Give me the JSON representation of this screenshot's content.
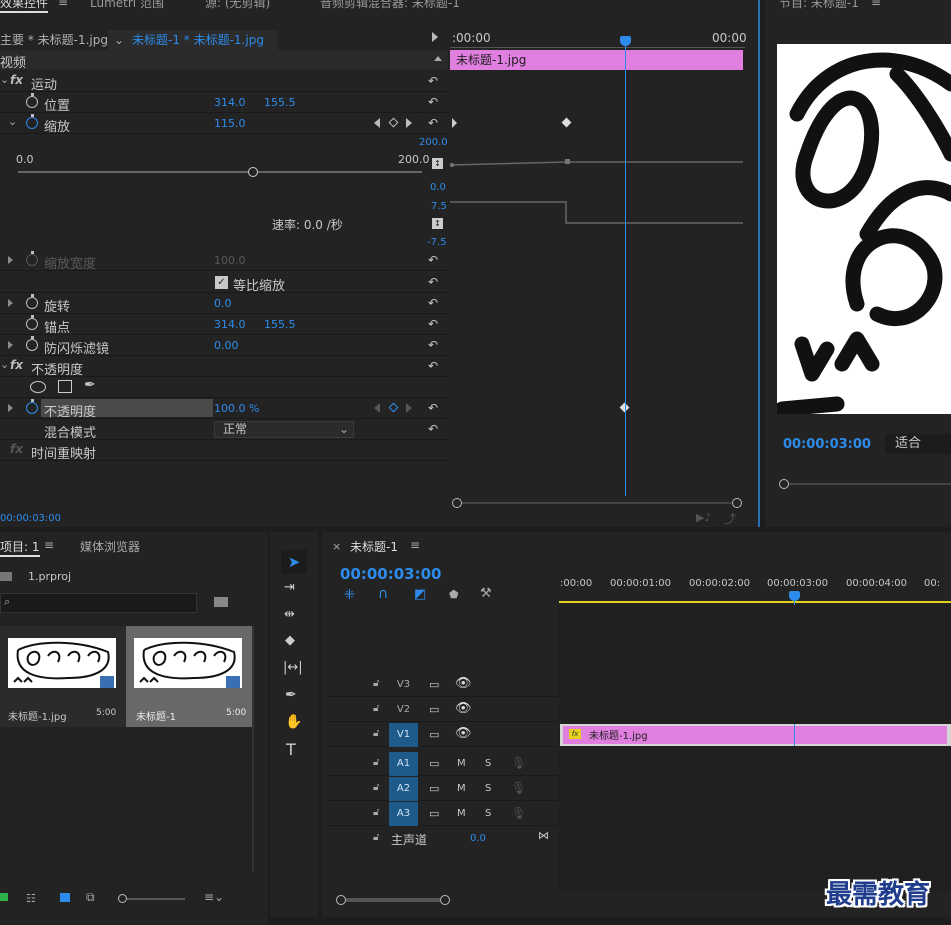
{
  "effect_controls": {
    "tab_label": "效果控件",
    "other_tabs": [
      "Lumetri 范围",
      "源: (无剪辑)",
      "音频剪辑混合器: 未标题-1"
    ],
    "source_label": "主要 * 未标题-1.jpg",
    "sequence_label": "未标题-1 * 未标题-1.jpg",
    "section_video": "视频",
    "timecode_start": ":00:00",
    "timecode_end": "00:00",
    "clip_name": "未标题-1.jpg",
    "bottom_timecode": "00:00:03:00",
    "motion": "运动",
    "position": {
      "label": "位置",
      "x": "314.0",
      "y": "155.5"
    },
    "scale": {
      "label": "缩放",
      "value": "115.0",
      "min": "0.0",
      "max": "200.0",
      "graph_top": "200.0",
      "graph_bottom": "0.0",
      "velocity_top": "7.5",
      "velocity_bottom": "-7.5",
      "rate": "速率: 0.0 /秒"
    },
    "scale_width": {
      "label": "缩放宽度",
      "value": "100.0"
    },
    "uniform_scale": "等比缩放",
    "rotation": {
      "label": "旋转",
      "value": "0.0"
    },
    "anchor": {
      "label": "锚点",
      "x": "314.0",
      "y": "155.5"
    },
    "antiflicker": {
      "label": "防闪烁滤镜",
      "value": "0.00"
    },
    "opacity_section": "不透明度",
    "opacity": {
      "label": "不透明度",
      "value": "100.0 %"
    },
    "blend_mode": {
      "label": "混合模式",
      "value": "正常"
    },
    "time_remap": "时间重映射"
  },
  "program": {
    "title": "节目: 未标题-1",
    "timecode": "00:00:03:00",
    "fit": "适合"
  },
  "project": {
    "tab": "项目: 1",
    "tab2": "媒体浏览器",
    "file": "1.prproj",
    "search_placeholder": "",
    "items": [
      {
        "name": "未标题-1.jpg",
        "duration": "5:00"
      },
      {
        "name": "未标题-1",
        "duration": "5:00"
      }
    ]
  },
  "timeline": {
    "close": "×",
    "title": "未标题-1",
    "timecode": "00:00:03:00",
    "ruler": [
      ":00:00",
      "00:00:01:00",
      "00:00:02:00",
      "00:00:03:00",
      "00:00:04:00",
      "00:"
    ],
    "tracks": [
      "V3",
      "V2",
      "V1",
      "A1",
      "A2",
      "A3"
    ],
    "mute": "M",
    "solo": "S",
    "master": "主声道",
    "master_value": "0.0",
    "clip_name": "未标题-1.jpg"
  },
  "watermark": "最需教育",
  "colors": {
    "accent": "#2d8ceb",
    "clip": "#e07fe0",
    "yellow": "#e4d11c"
  }
}
